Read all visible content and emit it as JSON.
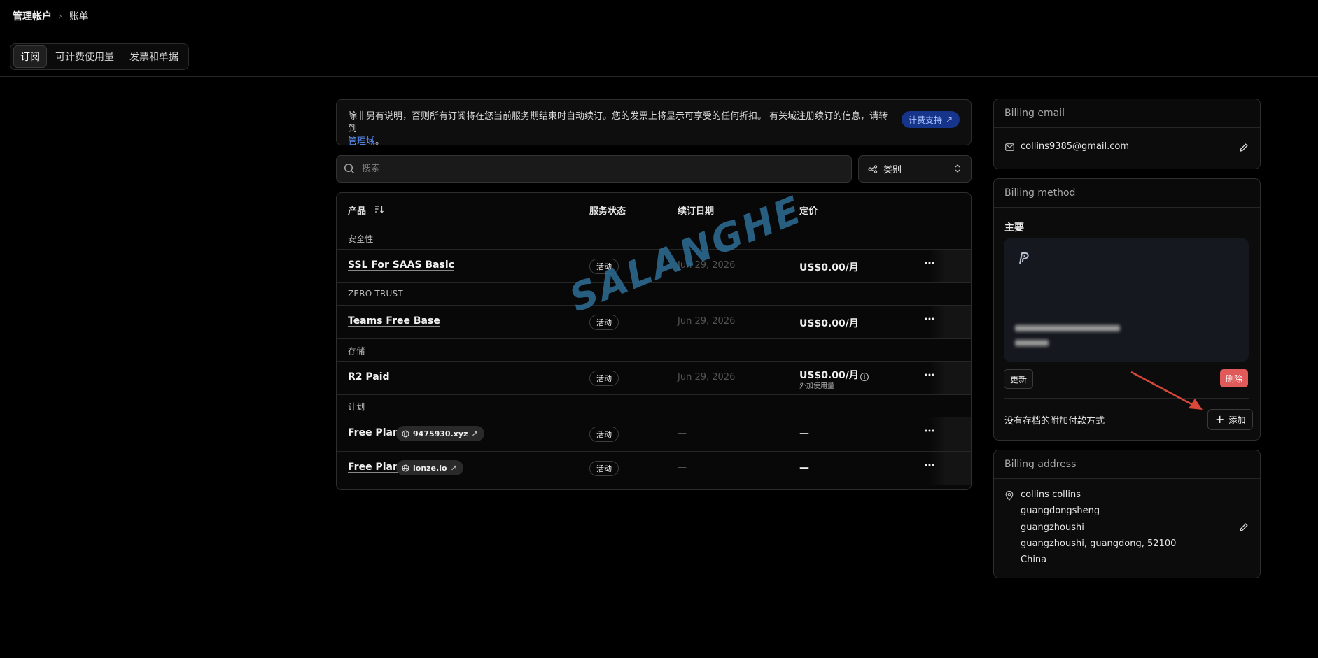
{
  "breadcrumb": {
    "root": "管理帐户",
    "current": "账单"
  },
  "tabs": [
    {
      "label": "订阅",
      "active": true
    },
    {
      "label": "可计费使用量",
      "active": false
    },
    {
      "label": "发票和单据",
      "active": false
    }
  ],
  "notice": {
    "text": "除非另有说明，否则所有订阅将在您当前服务期结束时自动续订。您的发票上将显示可享受的任何折扣。 有关域注册续订的信息，请转到",
    "link": "管理域",
    "suffix": "。",
    "support_button": "计费支持"
  },
  "search": {
    "placeholder": "搜索"
  },
  "filter": {
    "label": "类别"
  },
  "table": {
    "headers": {
      "product": "产品",
      "status": "服务状态",
      "renewal": "续订日期",
      "price": "定价"
    },
    "groups": [
      {
        "label": "安全性",
        "rows": [
          {
            "name": "SSL For SAAS Basic",
            "status": "活动",
            "date": "Jun 29, 2026",
            "price": "US$0.00/月"
          }
        ]
      },
      {
        "label": "ZERO TRUST",
        "rows": [
          {
            "name": "Teams Free Base",
            "status": "活动",
            "date": "Jun 29, 2026",
            "price": "US$0.00/月"
          }
        ]
      },
      {
        "label": "存储",
        "rows": [
          {
            "name": "R2 Paid",
            "status": "活动",
            "date": "Jun 29, 2026",
            "price": "US$0.00/月",
            "price_note": "外加使用量"
          }
        ]
      },
      {
        "label": "计划",
        "rows": [
          {
            "name": "Free Plan",
            "domain": "9475930.xyz",
            "status": "活动",
            "date": "—",
            "price": "—"
          },
          {
            "name": "Free Plan",
            "domain": "lonze.io",
            "status": "活动",
            "date": "—",
            "price": "—"
          }
        ]
      }
    ]
  },
  "billing_email": {
    "title": "Billing email",
    "email": "collins9385@gmail.com"
  },
  "billing_method": {
    "title": "Billing method",
    "primary_label": "主要",
    "update_button": "更新",
    "delete_button": "删除",
    "no_additional_text": "没有存档的附加付款方式",
    "add_button": "添加"
  },
  "billing_address": {
    "title": "Billing address",
    "lines": [
      "collins collins",
      "guangdongsheng",
      "guangzhoushi",
      "guangzhoushi, guangdong, 52100",
      "China"
    ]
  },
  "watermark": "SALANGHE",
  "colors": {
    "accent_blue": "#16348a",
    "delete_red": "#e05a5a",
    "arrow_red": "#d9483b"
  }
}
